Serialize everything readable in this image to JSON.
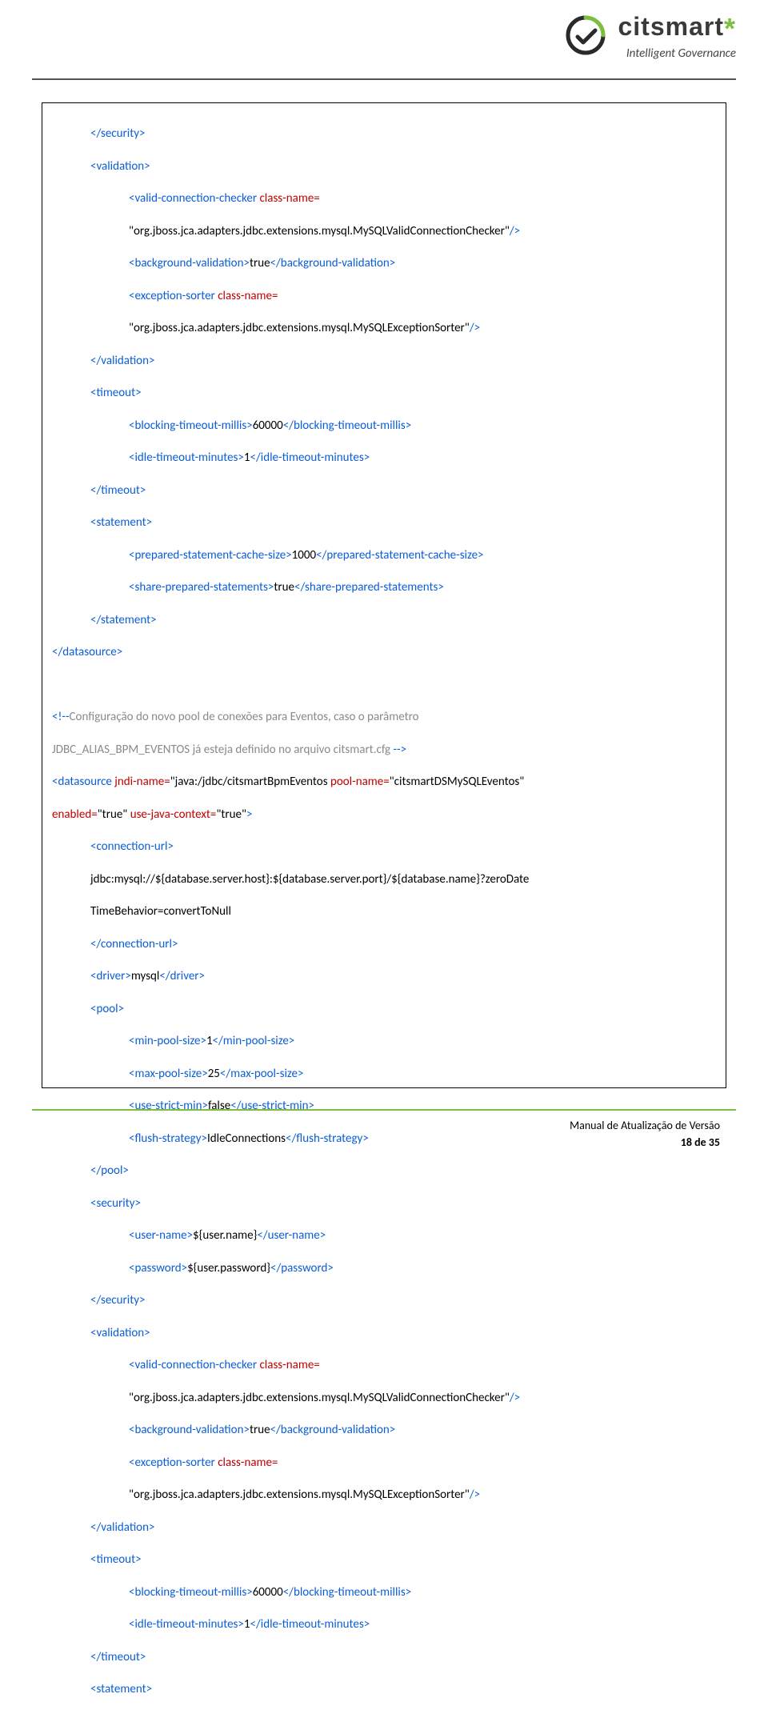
{
  "brand": {
    "name_prefix": "citsmart",
    "tagline": "Intelligent Governance"
  },
  "code": {
    "l01": "</security>",
    "l02": "<validation>",
    "l03a": "<valid-connection-checker",
    "l03b": " class-name=",
    "l04a": "\"org.jboss.jca.adapters.jdbc.extensions.mysql.MySQLValidConnectionChecker\"",
    "l04b": "/>",
    "l05a": "<background-validation>",
    "l05b": "true",
    "l05c": "</background-validation>",
    "l06a": "<exception-sorter",
    "l06b": " class-name=",
    "l07a": "\"org.jboss.jca.adapters.jdbc.extensions.mysql.MySQLExceptionSorter\"",
    "l07b": "/>",
    "l08": "</validation>",
    "l09": "<timeout>",
    "l10a": "<blocking-timeout-millis>",
    "l10b": "60000",
    "l10c": "</blocking-timeout-millis>",
    "l11a": "<idle-timeout-minutes>",
    "l11b": "1",
    "l11c": "</idle-timeout-minutes>",
    "l12": "</timeout>",
    "l13": "<statement>",
    "l14a": "<prepared-statement-cache-size>",
    "l14b": "1000",
    "l14c": "</prepared-statement-cache-size>",
    "l15a": "<share-prepared-statements>",
    "l15b": "true",
    "l15c": "</share-prepared-statements>",
    "l16": "</statement>",
    "l17": "</datasource>",
    "blank1": " ",
    "c1a": "<!--",
    "c1b": "Configuração do novo pool de conexões para Eventos, caso o parâmetro",
    "c2a": "JDBC_ALIAS_BPM_EVENTOS já esteja definido no arquivo citsmart.cfg",
    "c2b": " -->",
    "d1a": "<datasource",
    "d1b": " jndi-name=",
    "d1c": "\"java:/jdbc/citsmartBpmEventos",
    "d1d": " pool-name=",
    "d1e": "\"citsmartDSMySQLEventos\"",
    "d2a": "enabled=",
    "d2b": "\"true\"",
    "d2c": " use-java-context=",
    "d2d": "\"true\"",
    "d2e": ">",
    "cu1": "<connection-url>",
    "cu2": "jdbc:mysql://${database.server.host}:${database.server.port}/${database.name}?zeroDate",
    "cu3": "TimeBehavior=convertToNull",
    "cu4": "</connection-url>",
    "drv1": "<driver>",
    "drv2": "mysql",
    "drv3": "</driver>",
    "p1": "<pool>",
    "p2a": "<min-pool-size>",
    "p2b": "1",
    "p2c": "</min-pool-size>",
    "p3a": "<max-pool-size>",
    "p3b": "25",
    "p3c": "</max-pool-size>",
    "p4a": "<use-strict-min>",
    "p4b": "false",
    "p4c": "</use-strict-min>",
    "p5a": "<flush-strategy>",
    "p5b": "IdleConnections",
    "p5c": "</flush-strategy>",
    "p6": "</pool>",
    "s1": "<security>",
    "s2a": "<user-name>",
    "s2b": "${user.name}",
    "s2c": "</user-name>",
    "s3a": "<password>",
    "s3b": "${user.password}",
    "s3c": "</password>",
    "s4": "</security>",
    "v1": "<validation>",
    "v2a": "<valid-connection-checker",
    "v2b": " class-name=",
    "v3a": "\"org.jboss.jca.adapters.jdbc.extensions.mysql.MySQLValidConnectionChecker\"",
    "v3b": "/>",
    "v4a": "<background-validation>",
    "v4b": "true",
    "v4c": "</background-validation>",
    "v5a": "<exception-sorter",
    "v5b": " class-name=",
    "v6a": "\"org.jboss.jca.adapters.jdbc.extensions.mysql.MySQLExceptionSorter\"",
    "v6b": "/>",
    "v7": "</validation>",
    "t1": "<timeout>",
    "t2a": "<blocking-timeout-millis>",
    "t2b": "60000",
    "t2c": "</blocking-timeout-millis>",
    "t3a": "<idle-timeout-minutes>",
    "t3b": "1",
    "t3c": "</idle-timeout-minutes>",
    "t4": "</timeout>",
    "st1": "<statement>"
  },
  "footer": {
    "title": "Manual de Atualização de Versão",
    "page": "18 de 35"
  }
}
